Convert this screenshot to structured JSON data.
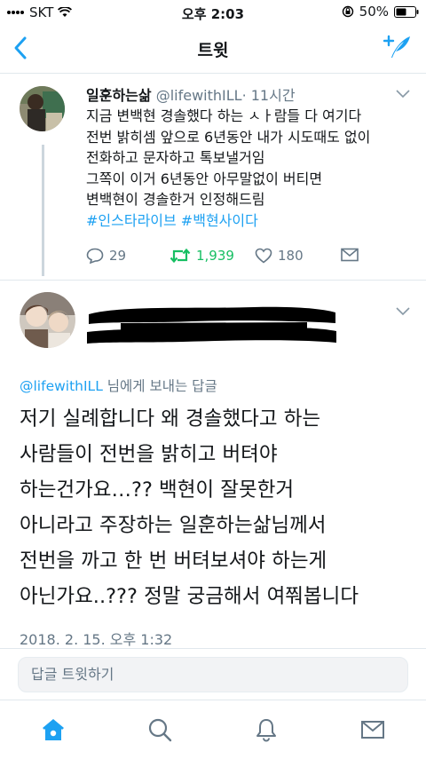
{
  "status_bar": {
    "carrier": "SKT",
    "time": "오후 2:03",
    "battery": "50%",
    "icons": [
      "signal-icon",
      "wifi-icon",
      "rotation-lock-icon",
      "battery-icon"
    ]
  },
  "nav": {
    "title": "트윗",
    "back_icon": "chevron-left-icon",
    "compose_icon": "compose-tweet-icon"
  },
  "colors": {
    "accent": "#1da1f2",
    "retweet": "#17bf63",
    "muted": "#657786",
    "text": "#14171a"
  },
  "tweet1": {
    "name": "일훈하는삶",
    "handle": "@lifewithILL",
    "time": "· 11시간",
    "lines": [
      "지금 변백현 경솔했다 하는 ㅅㅏ람들 다 여기다",
      "전번 밝히셈 앞으로 6년동안 내가 시도때도 없이",
      "전화하고 문자하고 톡보낼거임",
      "그쪽이 이거 6년동안 아무말없이 버티면",
      "변백현이 경솔한거 인정해드림"
    ],
    "hashtags": "#인스타라이브 #백현사이다",
    "replies": "29",
    "retweets": "1,939",
    "likes": "180"
  },
  "tweet2": {
    "reply_mention": "@lifewithILL",
    "reply_suffix": " 님에게 보내는 답글",
    "lines": [
      "저기 실례합니다 왜 경솔했다고 하는",
      "사람들이 전번을 밝히고 버텨야",
      "하는건가요…?? 백현이 잘못한거",
      "아니라고 주장하는 일훈하는삶님께서",
      "전번을 까고 한 번 버텨보셔야 하는게",
      "아닌가요..??? 정말 궁금해서 여쭤봅니다"
    ],
    "timestamp": "2018. 2. 15. 오후 1:32"
  },
  "reply_bar": {
    "placeholder": "답글 트윗하기"
  },
  "tab_bar": {
    "items": [
      "home-icon",
      "search-icon",
      "notifications-icon",
      "messages-icon"
    ],
    "active": "home-icon"
  }
}
